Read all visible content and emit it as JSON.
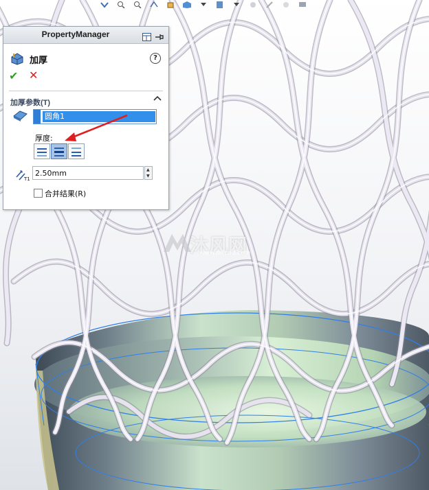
{
  "property_manager": {
    "title": "PropertyManager",
    "feature_name": "加厚",
    "help_icon": "?",
    "ok_icon": "✔",
    "cancel_icon": "✕",
    "group": {
      "title": "加厚参数(T)",
      "collapse_icon": "chevron-up",
      "face_selection": "圆角1",
      "thickness_label": "厚度:",
      "thickness_sides": [
        "side-1",
        "both-sides",
        "side-2"
      ],
      "active_side": "both-sides",
      "thickness_value": "2.50mm",
      "merge_result_label": "合并结果(R)",
      "merge_result_checked": false
    }
  },
  "watermark": {
    "brand": "沐风网",
    "url": "www.mfcad.com"
  },
  "colors": {
    "lattice": "#d9d6e4",
    "selection_blue": "#3390ea",
    "edge_highlight": "#2f7fe8",
    "arrow_red": "#e02020",
    "ok_green": "#3a9b2c",
    "cancel_red": "#d62020"
  }
}
